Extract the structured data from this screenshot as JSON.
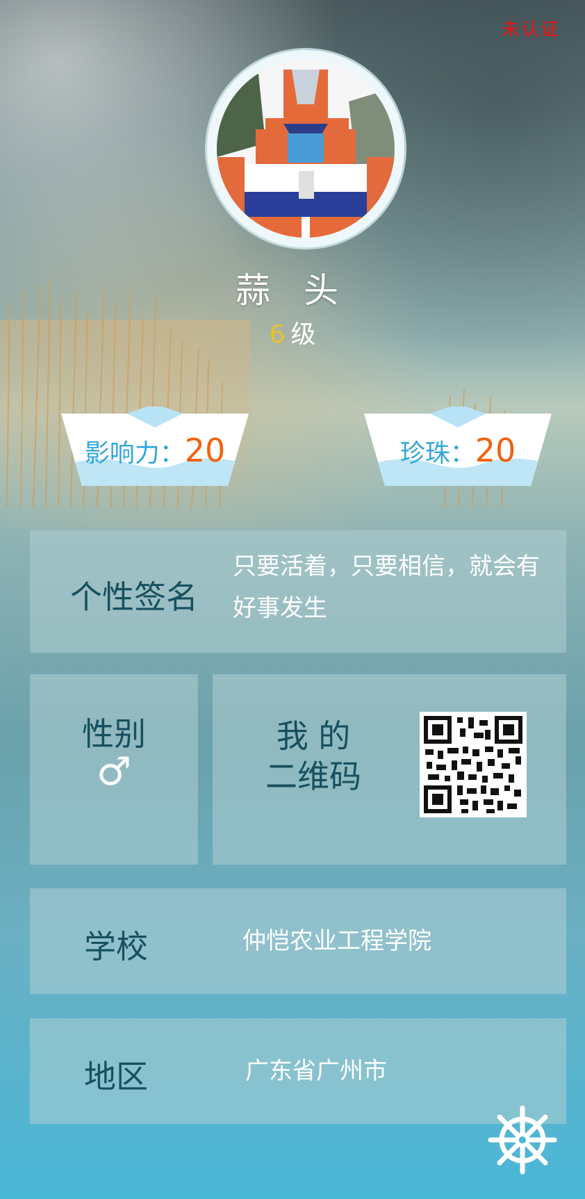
{
  "status": {
    "verification": "未认证"
  },
  "profile": {
    "name": "蒜 头",
    "level_number": "6",
    "level_unit": "级"
  },
  "stats": [
    {
      "label": "影响力：",
      "value": "20"
    },
    {
      "label": "珍珠：",
      "value": "20"
    }
  ],
  "signature": {
    "label": "个性签名",
    "value": "只要活着，只要相信，就会有好事发生"
  },
  "gender": {
    "label": "性别",
    "symbol": "♂"
  },
  "qrcode": {
    "label_line1": "我 的",
    "label_line2": "二维码"
  },
  "school": {
    "label": "学校",
    "value": "仲恺农业工程学院"
  },
  "region": {
    "label": "地区",
    "value": "广东省广州市"
  },
  "icons": {
    "fab": "ship-wheel-icon",
    "avatar": "robot-avatar-image"
  },
  "colors": {
    "accent_blue": "#34a5d9",
    "accent_orange": "#f0620f",
    "label_dark": "#17505f",
    "warning_red": "#ee1111",
    "level_gold": "#e8c22a"
  }
}
